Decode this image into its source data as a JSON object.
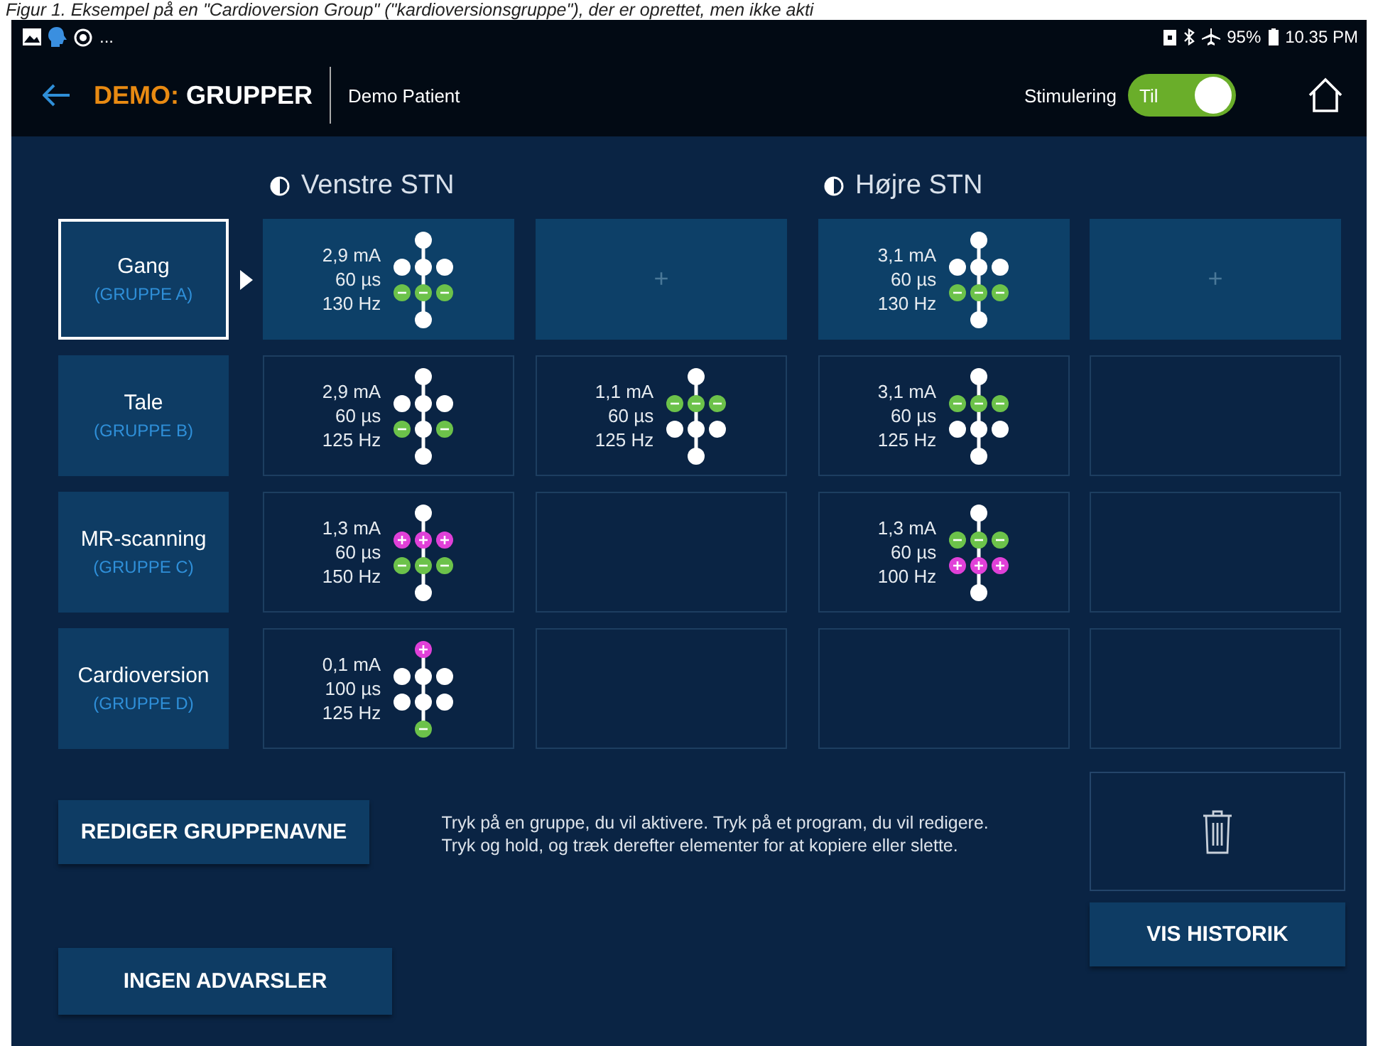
{
  "caption": "Figur 1. Eksempel på en \"Cardioversion Group\" (\"kardioversionsgruppe\"), der er oprettet, men ikke akti",
  "status_bar": {
    "left_text": "...",
    "battery": "95%",
    "time": "10.35 PM"
  },
  "header": {
    "prefix": "DEMO:",
    "title": "GRUPPER",
    "patient": "Demo Patient",
    "stimulation": {
      "label": "Stimulering",
      "state_label": "Til",
      "on": true
    }
  },
  "sides": [
    {
      "title": "Venstre STN"
    },
    {
      "title": "Højre STN"
    }
  ],
  "groups": [
    {
      "name": "Gang",
      "tag": "(GRUPPE A)",
      "selected": true,
      "active": true,
      "cells": [
        {
          "kind": "program",
          "amplitude": "2,9 mA",
          "pulse_width": "60 µs",
          "rate": "130 Hz",
          "lead": {
            "top": {
              "kind": "off"
            },
            "mid": [
              {
                "kind": "off"
              },
              {
                "kind": "off"
              },
              {
                "kind": "off"
              }
            ],
            "low": [
              {
                "kind": "neg"
              },
              {
                "kind": "neg"
              },
              {
                "kind": "neg"
              }
            ],
            "bottom": {
              "kind": "off"
            }
          }
        },
        {
          "kind": "add",
          "symbol": "+"
        },
        {
          "kind": "program",
          "amplitude": "3,1 mA",
          "pulse_width": "60 µs",
          "rate": "130 Hz",
          "lead": {
            "top": {
              "kind": "off"
            },
            "mid": [
              {
                "kind": "off"
              },
              {
                "kind": "off"
              },
              {
                "kind": "off"
              }
            ],
            "low": [
              {
                "kind": "neg"
              },
              {
                "kind": "neg"
              },
              {
                "kind": "neg"
              }
            ],
            "bottom": {
              "kind": "off"
            }
          }
        },
        {
          "kind": "add",
          "symbol": "+"
        }
      ]
    },
    {
      "name": "Tale",
      "tag": "(GRUPPE B)",
      "selected": false,
      "active": false,
      "cells": [
        {
          "kind": "program",
          "amplitude": "2,9 mA",
          "pulse_width": "60 µs",
          "rate": "125 Hz",
          "lead": {
            "top": {
              "kind": "off"
            },
            "mid": [
              {
                "kind": "off"
              },
              {
                "kind": "off"
              },
              {
                "kind": "off"
              }
            ],
            "low": [
              {
                "kind": "neg"
              },
              {
                "kind": "off"
              },
              {
                "kind": "neg"
              }
            ],
            "bottom": {
              "kind": "off"
            }
          }
        },
        {
          "kind": "program",
          "amplitude": "1,1 mA",
          "pulse_width": "60 µs",
          "rate": "125 Hz",
          "lead": {
            "top": {
              "kind": "off"
            },
            "mid": [
              {
                "kind": "neg"
              },
              {
                "kind": "neg"
              },
              {
                "kind": "neg"
              }
            ],
            "low": [
              {
                "kind": "off"
              },
              {
                "kind": "off"
              },
              {
                "kind": "off"
              }
            ],
            "bottom": {
              "kind": "off"
            }
          }
        },
        {
          "kind": "program",
          "amplitude": "3,1 mA",
          "pulse_width": "60 µs",
          "rate": "125 Hz",
          "lead": {
            "top": {
              "kind": "off"
            },
            "mid": [
              {
                "kind": "neg"
              },
              {
                "kind": "neg"
              },
              {
                "kind": "neg"
              }
            ],
            "low": [
              {
                "kind": "off"
              },
              {
                "kind": "off"
              },
              {
                "kind": "off"
              }
            ],
            "bottom": {
              "kind": "off"
            }
          }
        },
        {
          "kind": "empty"
        }
      ]
    },
    {
      "name": "MR-scanning",
      "tag": "(GRUPPE C)",
      "selected": false,
      "active": false,
      "cells": [
        {
          "kind": "program",
          "amplitude": "1,3 mA",
          "pulse_width": "60 µs",
          "rate": "150 Hz",
          "lead": {
            "top": {
              "kind": "off"
            },
            "mid": [
              {
                "kind": "pos"
              },
              {
                "kind": "pos"
              },
              {
                "kind": "pos"
              }
            ],
            "low": [
              {
                "kind": "neg"
              },
              {
                "kind": "neg"
              },
              {
                "kind": "neg"
              }
            ],
            "bottom": {
              "kind": "off"
            }
          }
        },
        {
          "kind": "empty"
        },
        {
          "kind": "program",
          "amplitude": "1,3 mA",
          "pulse_width": "60 µs",
          "rate": "100 Hz",
          "lead": {
            "top": {
              "kind": "off"
            },
            "mid": [
              {
                "kind": "neg"
              },
              {
                "kind": "neg"
              },
              {
                "kind": "neg"
              }
            ],
            "low": [
              {
                "kind": "pos"
              },
              {
                "kind": "pos"
              },
              {
                "kind": "pos"
              }
            ],
            "bottom": {
              "kind": "off"
            }
          }
        },
        {
          "kind": "empty"
        }
      ]
    },
    {
      "name": "Cardioversion",
      "tag": "(GRUPPE D)",
      "selected": false,
      "active": false,
      "cells": [
        {
          "kind": "program",
          "amplitude": "0,1 mA",
          "pulse_width": "100 µs",
          "rate": "125 Hz",
          "lead": {
            "top": {
              "kind": "pos"
            },
            "mid": [
              {
                "kind": "off"
              },
              {
                "kind": "off"
              },
              {
                "kind": "off"
              }
            ],
            "low": [
              {
                "kind": "off"
              },
              {
                "kind": "off"
              },
              {
                "kind": "off"
              }
            ],
            "bottom": {
              "kind": "neg"
            }
          }
        },
        {
          "kind": "empty"
        },
        {
          "kind": "empty"
        },
        {
          "kind": "empty"
        }
      ]
    }
  ],
  "buttons": {
    "rename": "REDIGER GRUPPENAVNE",
    "history": "VIS HISTORIK",
    "warnings": "INGEN ADVARSLER"
  },
  "instructions": "Tryk på en gruppe, du vil aktivere. Tryk på et program, du vil redigere.\nTryk og hold, og træk derefter elementer for at kopiere eller slette."
}
